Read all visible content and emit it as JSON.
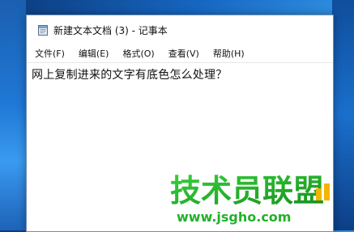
{
  "window": {
    "title": "新建文本文档 (3) - 记事本"
  },
  "menu": {
    "items": [
      {
        "label": "文件(F)"
      },
      {
        "label": "编辑(E)"
      },
      {
        "label": "格式(O)"
      },
      {
        "label": "查看(V)"
      },
      {
        "label": "帮助(H)"
      }
    ]
  },
  "editor": {
    "text": "网上复制进来的文字有底色怎么处理？"
  },
  "watermark": {
    "brand": "技术员联盟",
    "url": "www.jsgho.com"
  },
  "colors": {
    "desktop_blue": "#1667c2",
    "window_bg": "#ffffff",
    "watermark_green": "#22b12a"
  },
  "icons": {
    "app": "notepad-icon"
  }
}
